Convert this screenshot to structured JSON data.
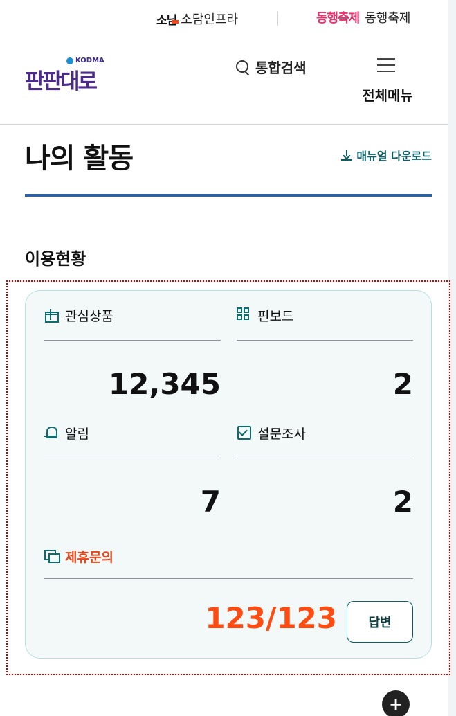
{
  "partners": {
    "sodam": {
      "logo_text": "소님",
      "label": "소담인프라"
    },
    "donghaeng": {
      "logo_text": "동행축제",
      "label": "동행축제"
    }
  },
  "header": {
    "brand": {
      "org": "KODMA",
      "name": "판판대로"
    },
    "search_label": "통합검색",
    "menu_label": "전체메뉴"
  },
  "page": {
    "title": "나의 활동",
    "manual_download": "매뉴얼 다운로드",
    "section_title": "이용현황"
  },
  "stats": {
    "favorites": {
      "label": "관심상품",
      "value": "12,345"
    },
    "pinboard": {
      "label": "핀보드",
      "value": "2"
    },
    "alerts": {
      "label": "알림",
      "value": "7"
    },
    "survey": {
      "label": "설문조사",
      "value": "2"
    }
  },
  "inquiry": {
    "label": "제휴문의",
    "count": "123/123",
    "answer_button": "답변"
  },
  "fab_label": "+",
  "colors": {
    "accent_teal": "#0f5e66",
    "accent_orange": "#ff4c12",
    "title_bar": "#2f61a4",
    "card_bg": "#f3f9f9"
  }
}
